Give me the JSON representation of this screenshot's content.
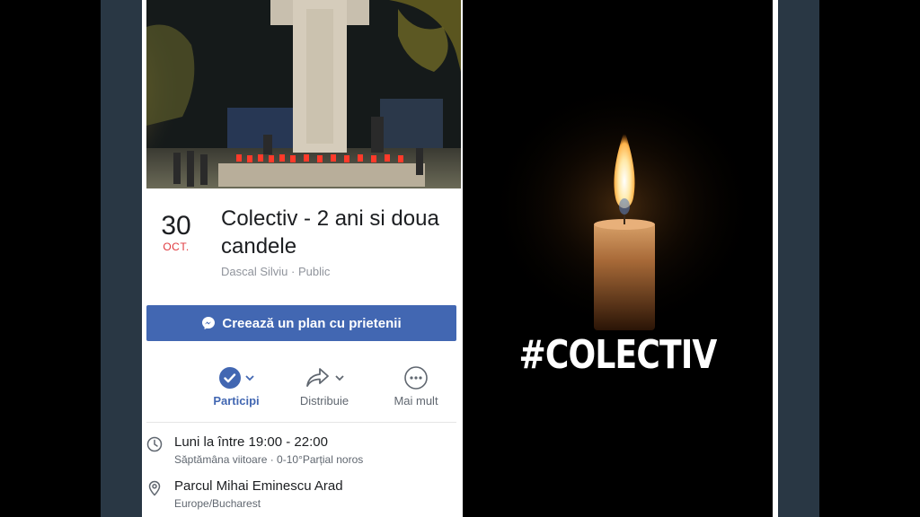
{
  "event": {
    "day": "30",
    "month": "OCT.",
    "title_line1": "Colectiv - 2 ani si doua",
    "title_line2": "candele",
    "host": "Dascal Silviu · Public"
  },
  "plan_button": {
    "label": "Creează un plan cu prietenii",
    "icon": "messenger-icon"
  },
  "actions": [
    {
      "label": "Participi",
      "icon": "check-circle-icon"
    },
    {
      "label": "Distribuie",
      "icon": "share-icon"
    },
    {
      "label": "Mai mult",
      "icon": "more-icon"
    }
  ],
  "time": {
    "main": "Luni la între 19:00 - 22:00",
    "sub": "Săptămâna viitoare · 0-10°Parțial noros",
    "icon": "clock-icon"
  },
  "location": {
    "main": "Parcul Mihai Eminescu Arad",
    "sub": "Europe/Bucharest",
    "icon": "location-pin-icon"
  },
  "candle_image": {
    "hashtag": "#COLECTIV"
  },
  "colors": {
    "accent": "#4267b2",
    "date_red": "#e0393e",
    "frame": "#293744"
  }
}
